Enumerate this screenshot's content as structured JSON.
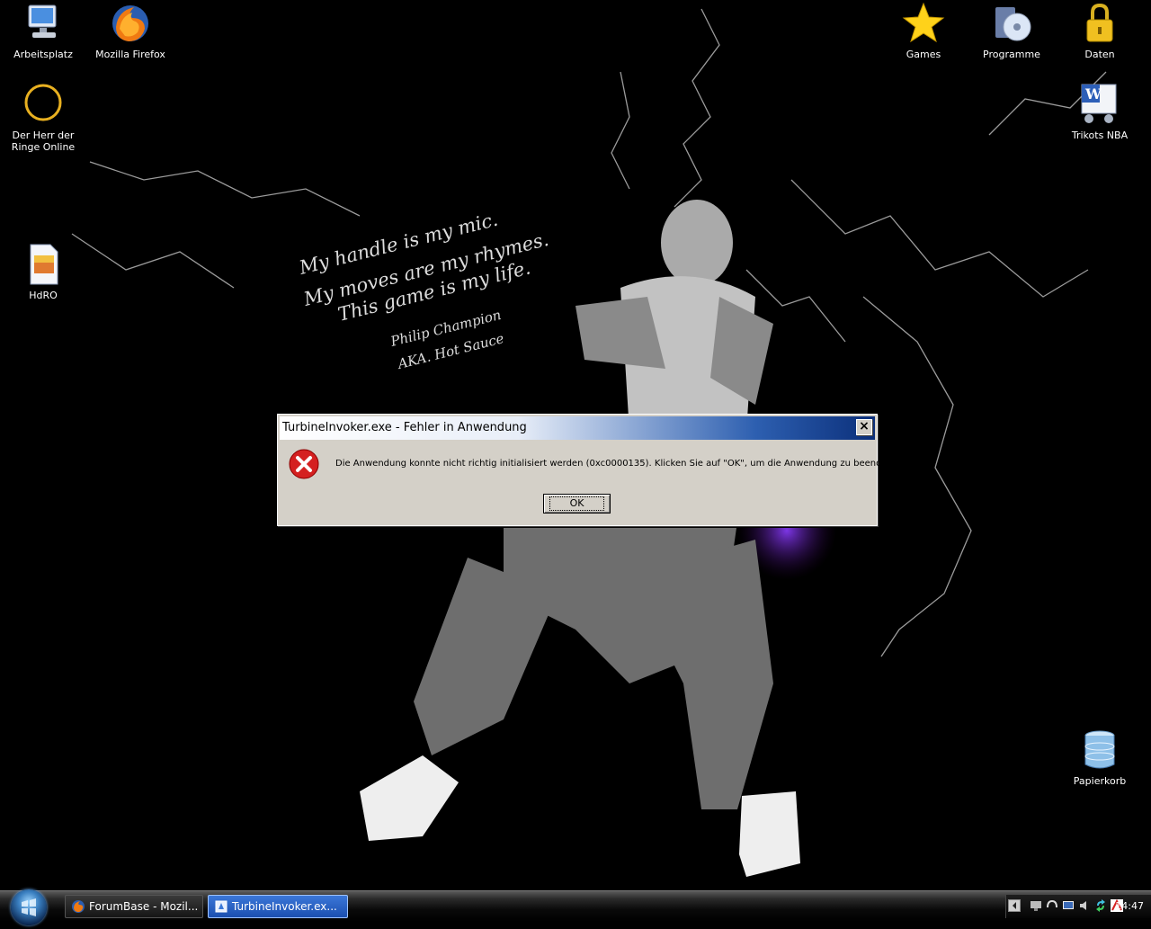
{
  "desktop": {
    "icons": [
      {
        "label": "Arbeitsplatz",
        "icon": "computer-icon"
      },
      {
        "label": "Mozilla Firefox",
        "icon": "firefox-icon"
      },
      {
        "label": "Der Herr der Ringe Online",
        "icon": "ring-icon"
      },
      {
        "label": "HdRO",
        "icon": "document-icon"
      },
      {
        "label": "Games",
        "icon": "star-icon"
      },
      {
        "label": "Programme",
        "icon": "programs-icon"
      },
      {
        "label": "Daten",
        "icon": "lock-folder-icon"
      },
      {
        "label": "Trikots NBA",
        "icon": "word-document-icon"
      },
      {
        "label": "Papierkorb",
        "icon": "recycle-bin-icon"
      }
    ],
    "wallpaper_text": [
      "My handle is my mic.",
      "My moves are my rhymes.",
      "This game is my life.",
      "Philip Champion",
      "AKA. Hot Sauce"
    ]
  },
  "dialog": {
    "title": "TurbineInvoker.exe - Fehler in Anwendung",
    "close_label": "×",
    "message": "Die Anwendung konnte nicht richtig initialisiert werden (0xc0000135). Klicken Sie auf \"OK\", um die Anwendung zu beenden.",
    "ok_label": "OK"
  },
  "taskbar": {
    "tasks": [
      {
        "label": "ForumBase - Mozil...",
        "icon": "firefox-icon",
        "active": false
      },
      {
        "label": "TurbineInvoker.ex...",
        "icon": "app-icon",
        "active": true
      }
    ],
    "clock": "14:47"
  },
  "colors": {
    "title_gradient_end": "#0b2f7a",
    "taskbar_active": "#1b4fb0",
    "error_red": "#d42020"
  }
}
